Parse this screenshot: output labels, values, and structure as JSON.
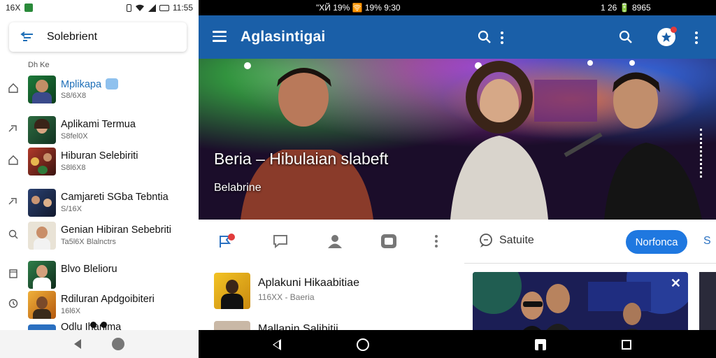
{
  "status_left": {
    "left_text": "16X",
    "time": "11:55"
  },
  "status_right": {
    "segment_a": "\"ХЙ 19% 🛜 19% 9:30",
    "segment_b": "1 26 🔋 8965"
  },
  "left_panel": {
    "search_text": "Solebrient",
    "section_label": "Dh Ke",
    "items": [
      {
        "title": "Mplikapa",
        "sub": "S8/6X8",
        "active": true
      },
      {
        "title": "Aplikami Termua",
        "sub": "S8fel0X",
        "active": false
      },
      {
        "title": "Hiburan Selebiriti",
        "sub": "S8l6X8",
        "active": false
      },
      {
        "title": "Camjareti SGba Tebntia",
        "sub": "S/16X",
        "active": false
      },
      {
        "title": "Genian Hibiran Sebebriti",
        "sub": "Ta5l6X Blalnctrs",
        "active": false
      },
      {
        "title": "Blvo Blelioru",
        "sub": "",
        "active": false
      },
      {
        "title": "Rdiluran Apdgoibiteri",
        "sub": "16l6X",
        "active": false
      },
      {
        "title": "Odlu Ihanima",
        "sub": "",
        "active": false
      }
    ]
  },
  "app_bar": {
    "title": "Aglasintigai"
  },
  "hero": {
    "title": "Beria – Hibulaian slabeft",
    "subtitle": "Belabrine"
  },
  "list2": {
    "item1_title": "Aplakuni Hikaabitiae",
    "item1_sub": "116XX - Baeria",
    "item2_title": "Mallanin Salibitii"
  },
  "right_panel": {
    "satuite_label": "Satuite",
    "button_label": "Norfonca",
    "more_label": "S"
  },
  "colors": {
    "app_bar": "#1a5fa8",
    "accent": "#1f78e0",
    "notification": "#e23b3b"
  }
}
